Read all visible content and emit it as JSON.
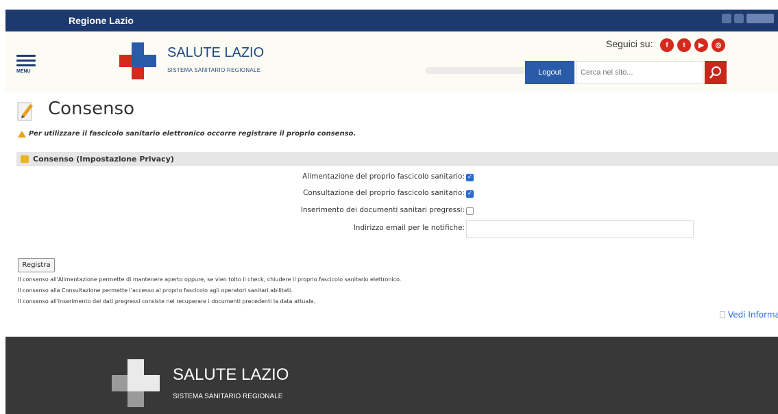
{
  "header": {
    "region_label": "Regione Lazio",
    "menu_label": "MENU",
    "brand_title": "SALUTE LAZIO",
    "brand_subtitle": "SISTEMA SANITARIO REGIONALE",
    "social_label": "Seguici su:",
    "social_icons": [
      "facebook-icon",
      "twitter-icon",
      "youtube-icon",
      "instagram-icon"
    ],
    "logout_label": "Logout",
    "search_placeholder": "Cerca nel sito..."
  },
  "page": {
    "title": "Consenso",
    "warning": "Per utilizzare il fascicolo sanitario elettronico occorre registrare il proprio consenso.",
    "section_title": "Consenso (Impostazione Privacy)"
  },
  "form": {
    "fields": [
      {
        "label": "Alimentazione del proprio fascicolo sanitario:",
        "checked": true
      },
      {
        "label": "Consultazione del proprio fascicolo sanitario:",
        "checked": true
      },
      {
        "label": "Inserimento dei documenti sanitari pregressi:",
        "checked": false
      }
    ],
    "email_label": "Indirizzo email per le notifiche:",
    "email_value": "",
    "submit_label": "Registra"
  },
  "notes": [
    "Il consenso all'Alimentazione permette di mantenere aperto oppure, se vien tolto il check, chiudere il proprio fascicolo sanitario elettronico.",
    "Il consenso alla Consultazione permette l'accesso al proprio fascicolo agli operatori sanitari abilitati.",
    "Il consenso all'inserimento dei dati pregressi consiste nel recuperare i documenti precedenti la data attuale."
  ],
  "vedi_link": "Vedi Informa",
  "footer": {
    "brand_title": "SALUTE LAZIO",
    "brand_subtitle": "SISTEMA SANITARIO REGIONALE"
  },
  "colors": {
    "region_bar": "#1d3a6e",
    "brand_blue": "#1f4a86",
    "accent_red": "#c9271b",
    "checkbox_blue": "#2a6bd1",
    "footer_bg": "#383838"
  }
}
